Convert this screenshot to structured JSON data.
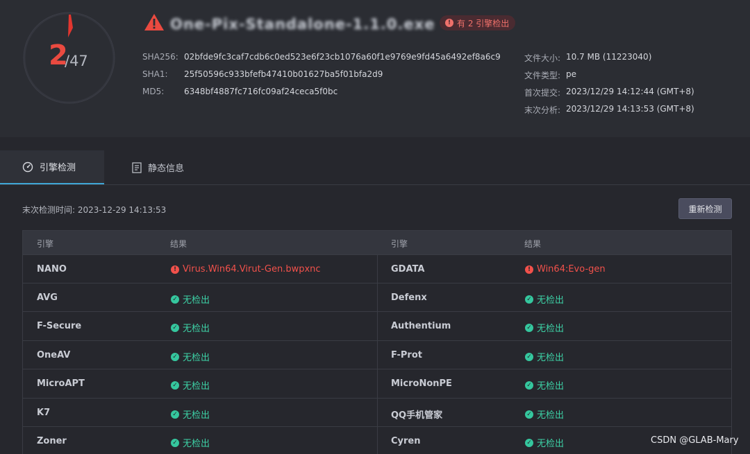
{
  "gauge": {
    "detected": "2",
    "total": "/47",
    "ratio": 0.0426
  },
  "file": {
    "name": "One-Pix-Standalone-1.1.0.exe",
    "badge": "有 2 引擎检出",
    "hashes": [
      {
        "label": "SHA256:",
        "value": "02bfde9fc3caf7cdb6c0ed523e6f23cb1076a60f1e9769e9fd45a6492ef8a6c9"
      },
      {
        "label": "SHA1:",
        "value": "25f50596c933bfefb47410b01627ba5f01bfa2d9"
      },
      {
        "label": "MD5:",
        "value": "6348bf4887fc716fc09af24ceca5f0bc"
      }
    ],
    "info": [
      {
        "label": "文件大小:",
        "value": "10.7 MB (11223040)"
      },
      {
        "label": "文件类型:",
        "value": "pe"
      },
      {
        "label": "首次提交:",
        "value": "2023/12/29 14:12:44 (GMT+8)"
      },
      {
        "label": "末次分析:",
        "value": "2023/12/29 14:13:53 (GMT+8)"
      }
    ]
  },
  "tabs": [
    {
      "label": "引擎检测",
      "icon": "gauge-icon",
      "active": true
    },
    {
      "label": "静态信息",
      "icon": "document-icon",
      "active": false
    }
  ],
  "scan": {
    "last_time": "末次检测时间: 2023-12-29 14:13:53",
    "rescan_label": "重新检测"
  },
  "table": {
    "headers": [
      "引擎",
      "结果",
      "引擎",
      "结果"
    ],
    "rows": [
      {
        "left": {
          "engine": "NANO",
          "result": "Virus.Win64.Virut-Gen.bwpxnc",
          "status": "mal"
        },
        "right": {
          "engine": "GDATA",
          "result": "Win64:Evo-gen",
          "status": "mal"
        }
      },
      {
        "left": {
          "engine": "AVG",
          "result": "无检出",
          "status": "clean"
        },
        "right": {
          "engine": "Defenx",
          "result": "无检出",
          "status": "clean"
        }
      },
      {
        "left": {
          "engine": "F-Secure",
          "result": "无检出",
          "status": "clean"
        },
        "right": {
          "engine": "Authentium",
          "result": "无检出",
          "status": "clean"
        }
      },
      {
        "left": {
          "engine": "OneAV",
          "result": "无检出",
          "status": "clean"
        },
        "right": {
          "engine": "F-Prot",
          "result": "无检出",
          "status": "clean"
        }
      },
      {
        "left": {
          "engine": "MicroAPT",
          "result": "无检出",
          "status": "clean"
        },
        "right": {
          "engine": "MicroNonPE",
          "result": "无检出",
          "status": "clean"
        }
      },
      {
        "left": {
          "engine": "K7",
          "result": "无检出",
          "status": "clean"
        },
        "right": {
          "engine": "QQ手机管家",
          "result": "无检出",
          "status": "clean"
        }
      },
      {
        "left": {
          "engine": "Zoner",
          "result": "无检出",
          "status": "clean"
        },
        "right": {
          "engine": "Cyren",
          "result": "无检出",
          "status": "clean"
        }
      }
    ]
  },
  "watermark": "CSDN @GLAB-Mary",
  "colors": {
    "danger": "#ea4a40",
    "clean": "#3dd3a7",
    "accent": "#3fa7d6",
    "background": "#26272d"
  }
}
